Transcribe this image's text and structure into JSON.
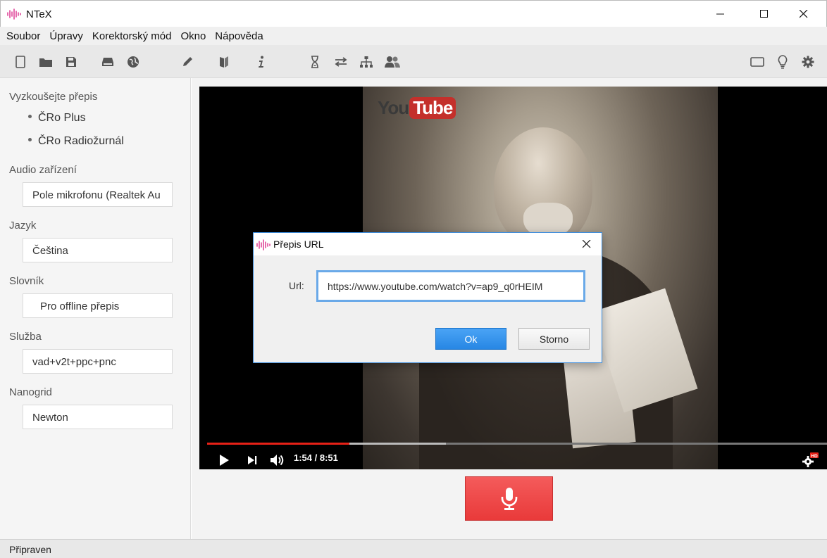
{
  "window": {
    "title": "NTeX",
    "accent_color": "#e0489a"
  },
  "menu": {
    "items": [
      "Soubor",
      "Úpravy",
      "Korektorský mód",
      "Okno",
      "Nápověda"
    ]
  },
  "toolbar": {
    "icons": [
      "new-document-icon",
      "open-folder-icon",
      "save-icon",
      "drive-icon",
      "globe-icon",
      "pencil-icon",
      "book-icon",
      "info-icon",
      "hourglass-icon",
      "swap-arrows-icon",
      "hierarchy-icon",
      "users-icon",
      "window-icon",
      "lightbulb-icon",
      "gear-icon"
    ]
  },
  "sidebar": {
    "try_title": "Vyzkoušejte přepis",
    "try_items": [
      "ČRo Plus",
      "ČRo Radiožurnál"
    ],
    "audio_title": "Audio zařízení",
    "audio_value": "Pole mikrofonu (Realtek Au",
    "language_title": "Jazyk",
    "language_value": "Čeština",
    "dictionary_title": "Slovník",
    "dictionary_value": "Pro offline přepis",
    "service_title": "Služba",
    "service_value": "vad+v2t+ppc+pnc",
    "nanogrid_title": "Nanogrid",
    "nanogrid_value": "Newton"
  },
  "video": {
    "logo_you": "You",
    "logo_tube": "Tube",
    "time": "1:54 / 8:51",
    "progress_fraction": 0.23,
    "buffer_fraction": 0.385,
    "progress_color": "#e62117"
  },
  "record": {
    "color": "#ef4444"
  },
  "dialog": {
    "title": "Přepis URL",
    "url_label": "Url:",
    "url_value": "https://www.youtube.com/watch?v=ap9_q0rHEIM",
    "ok_label": "Ok",
    "cancel_label": "Storno"
  },
  "status": {
    "text": "Připraven"
  }
}
